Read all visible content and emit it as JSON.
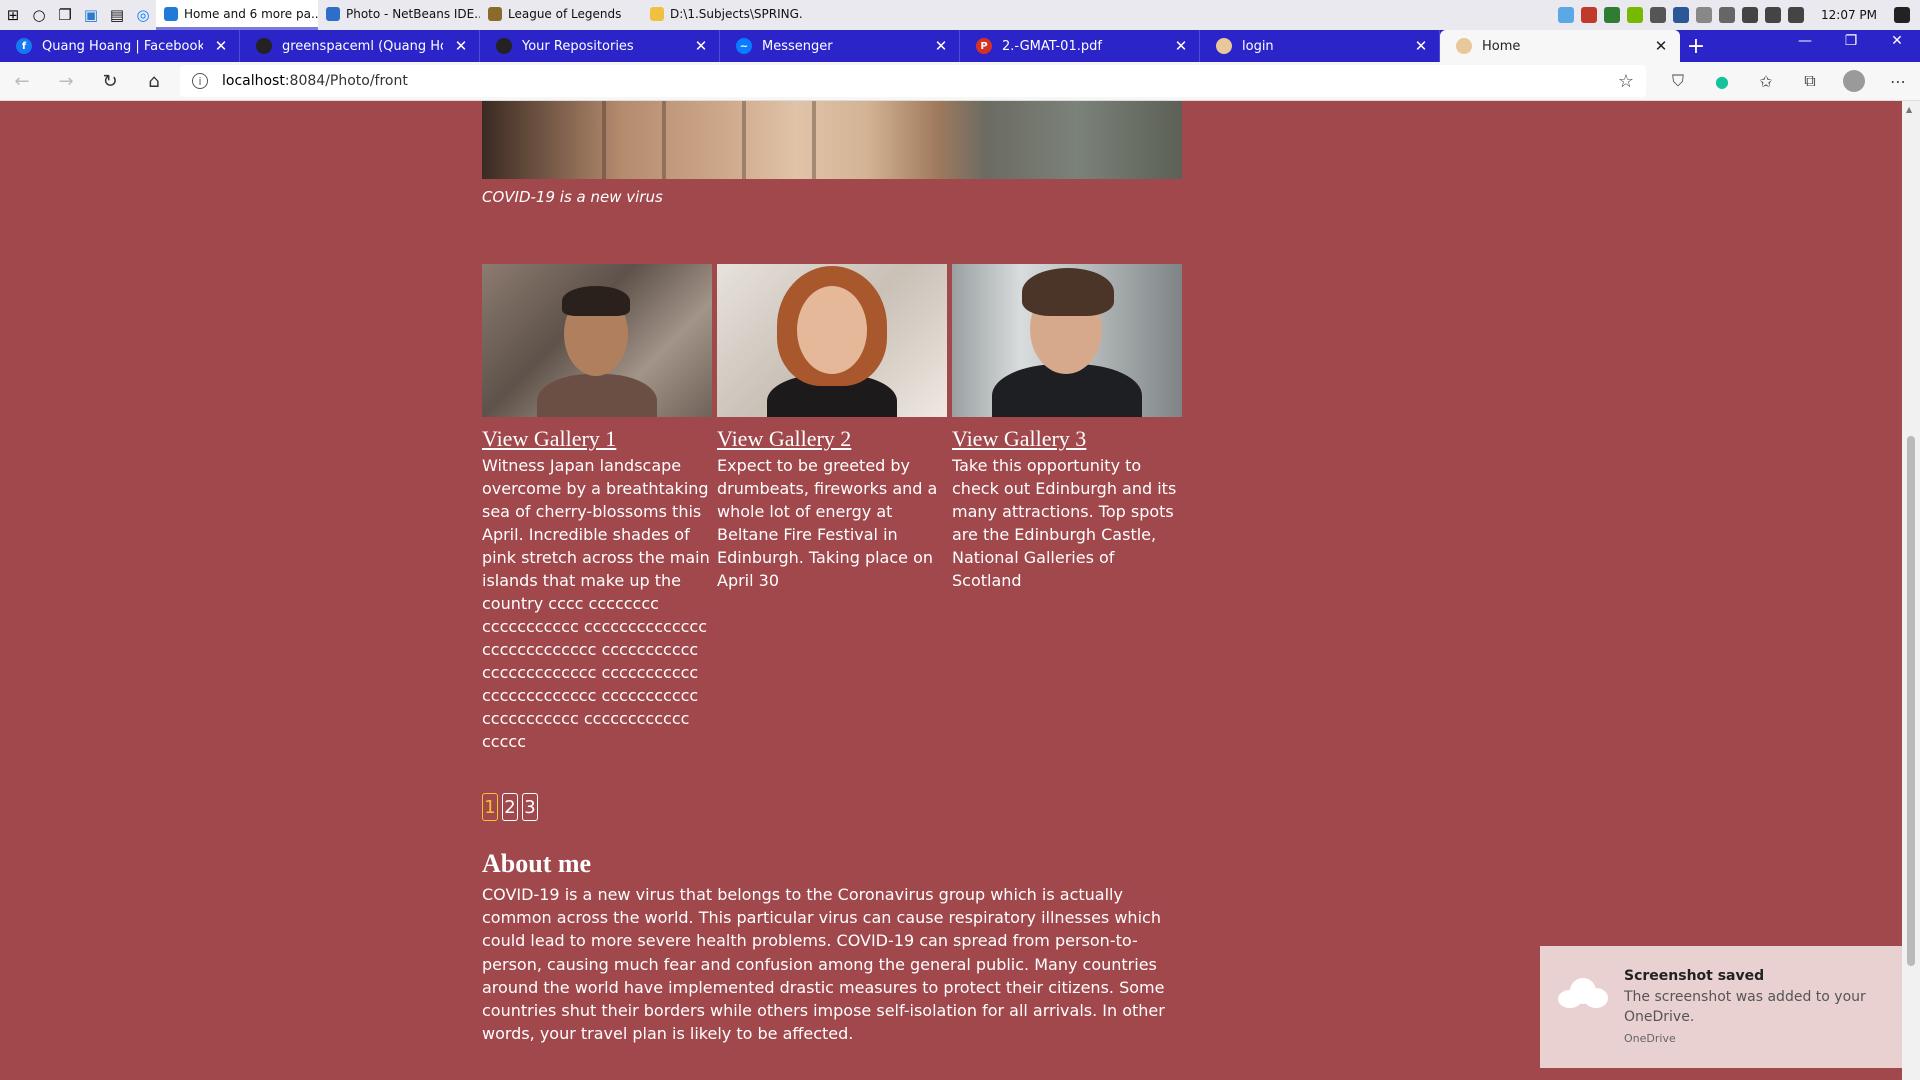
{
  "taskbar": {
    "apps": [
      {
        "label": "Home and 6 more pa...",
        "icon": "edge-icon",
        "color": "#1f7ad8",
        "active": true
      },
      {
        "label": "Photo - NetBeans IDE...",
        "icon": "netbeans-icon",
        "color": "#2d6ec8",
        "active": false
      },
      {
        "label": "League of Legends",
        "icon": "league-icon",
        "color": "#8b6a2c",
        "active": false
      },
      {
        "label": "D:\\1.Subjects\\SPRING...",
        "icon": "folder-icon",
        "color": "#f0c040",
        "active": false
      }
    ],
    "clock": "12:07 PM"
  },
  "tabs": [
    {
      "title": "Quang Hoang | Facebook",
      "icon": "facebook-icon",
      "color": "#1877f2",
      "glyph": "f"
    },
    {
      "title": "greenspaceml (Quang Hoang)",
      "icon": "github-icon",
      "color": "#222222",
      "glyph": ""
    },
    {
      "title": "Your Repositories",
      "icon": "github-icon",
      "color": "#222222",
      "glyph": ""
    },
    {
      "title": "Messenger",
      "icon": "messenger-icon",
      "color": "#0a7cff",
      "glyph": "~"
    },
    {
      "title": "2.-GMAT-01.pdf",
      "icon": "pdf-icon",
      "color": "#d93025",
      "glyph": "P"
    },
    {
      "title": "login",
      "icon": "page-icon",
      "color": "#e8c89a",
      "glyph": ""
    },
    {
      "title": "Home",
      "icon": "page-icon",
      "color": "#e8c89a",
      "glyph": "",
      "active": true
    }
  ],
  "address": {
    "host": "localhost",
    "path": ":8084/Photo/front"
  },
  "page": {
    "hero_caption": "COVID-19 is a new virus",
    "galleries": [
      {
        "link": "View Gallery 1",
        "description": "Witness Japan landscape overcome by a breathtaking sea of cherry-blossoms this April. Incredible shades of pink stretch across the main islands that make up the country cccc cccccccc ccccccccccc cccccccccccccc ccccccccccccc ccccccccccc ccccccccccccc ccccccccccc ccccccccccccc ccccccccccc ccccccccccc cccccccccccc ccccc"
      },
      {
        "link": "View Gallery 2",
        "description": "Expect to be greeted by drumbeats, fireworks and a whole lot of energy at Beltane Fire Festival in Edinburgh. Taking place on April 30"
      },
      {
        "link": "View Gallery 3",
        "description": "Take this opportunity to check out Edinburgh and its many attractions. Top spots are the Edinburgh Castle, National Galleries of Scotland"
      }
    ],
    "pages": [
      "1",
      "2",
      "3"
    ],
    "active_page": "1",
    "about_title": "About me",
    "about_text": "COVID-19 is a new virus that belongs to the Coronavirus group which is actually common across the world. This particular virus can cause respiratory illnesses which could lead to more severe health problems. COVID-19 can spread from person-to-person, causing much fear and confusion among the general public. Many countries around the world have implemented drastic measures to protect their citizens. Some countries shut their borders while others impose self-isolation for all arrivals. In other words, your travel plan is likely to be affected."
  },
  "toast": {
    "title": "Screenshot saved",
    "message": "The screenshot was added to your OneDrive.",
    "source": "OneDrive"
  },
  "colors": {
    "page_background": "#a0484c",
    "tab_strip": "#2b24c8",
    "pager_active": "#f2c230"
  }
}
